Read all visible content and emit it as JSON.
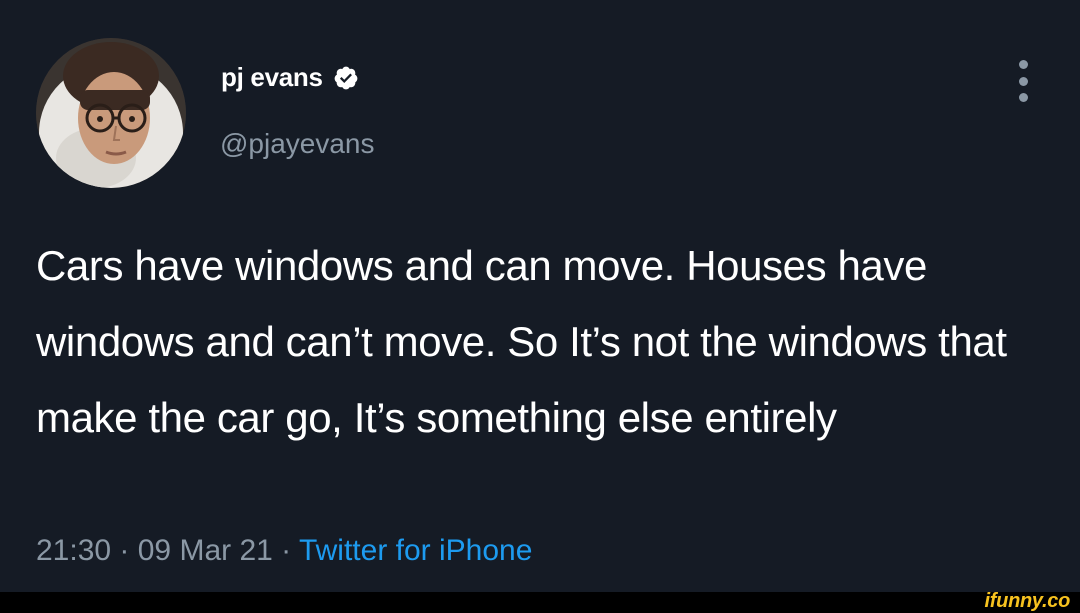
{
  "tweet": {
    "author": {
      "display_name": "pj evans",
      "handle": "@pjayevans",
      "verified": true
    },
    "text": "Cars have windows and can move. Houses have windows and can’t move. So It’s not the windows that make the car go, It’s something else entirely",
    "time": "21:30",
    "separator": " · ",
    "date": "09 Mar 21",
    "separator2": "· ",
    "source": "Twitter for iPhone"
  },
  "icons": {
    "verified": "verified-badge-icon",
    "more": "more-vertical-icon"
  },
  "colors": {
    "background": "#151b25",
    "text_primary": "#ffffff",
    "text_secondary": "#8b98a5",
    "link": "#1d9bf0",
    "watermark": "#f7c21f"
  },
  "watermark": {
    "text": "ifunny.co"
  }
}
